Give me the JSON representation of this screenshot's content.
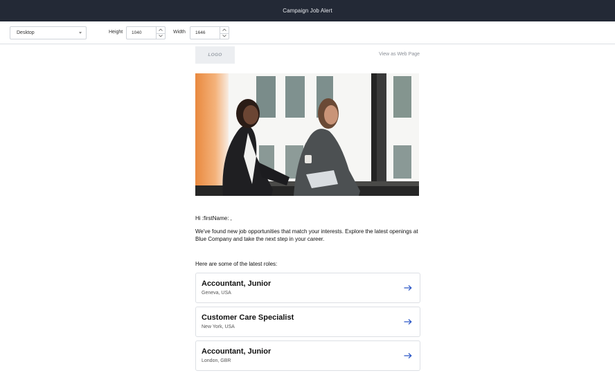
{
  "window": {
    "title": "Campaign Job Alert"
  },
  "toolbar": {
    "device": {
      "value": "Desktop"
    },
    "height": {
      "label": "Height",
      "value": "1040"
    },
    "width": {
      "label": "Width",
      "value": "1646"
    }
  },
  "email": {
    "logo_text": "LOGO",
    "web_link": "View as Web Page",
    "greeting": "Hi :firstName: ,",
    "intro": "We've found new job opportunities that match your interests. Explore the latest openings at Blue Company and take the next step in your career.",
    "roles_heading": "Here are some of the latest roles:",
    "jobs": [
      {
        "title": "Accountant, Junior",
        "location": "Geneva, USA"
      },
      {
        "title": "Customer Care Specialist",
        "location": "New York, USA"
      },
      {
        "title": "Accountant, Junior",
        "location": "London, GBR"
      }
    ]
  },
  "colors": {
    "titlebar": "#232936",
    "arrow": "#2a56c6"
  },
  "icons": {
    "job_arrow": "arrow-right-icon",
    "stepper_up": "chevron-up-icon",
    "stepper_down": "chevron-down-icon",
    "select_caret": "caret-down-icon"
  }
}
